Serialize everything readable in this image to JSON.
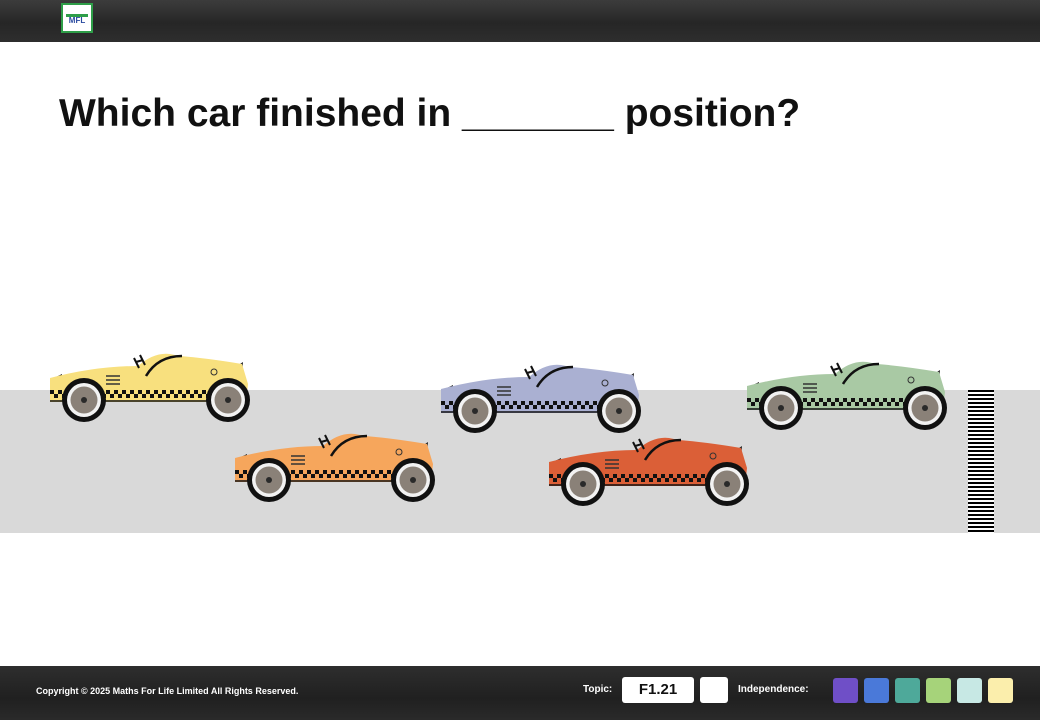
{
  "question": {
    "text": "Which car finished in _______ position?"
  },
  "cars": [
    {
      "id": "yellow",
      "body_color": "#f8e07e"
    },
    {
      "id": "orange",
      "body_color": "#f6a65c"
    },
    {
      "id": "blue",
      "body_color": "#aab0d2"
    },
    {
      "id": "red",
      "body_color": "#db5f37"
    },
    {
      "id": "green",
      "body_color": "#a9c9a4"
    }
  ],
  "footer": {
    "copyright": "Copyright © 2025 Maths For Life Limited All Rights Reserved.",
    "topic_label": "Topic:",
    "topic_code": "F1.21",
    "independence_label": "Independence:",
    "independence_colors": [
      "#6f4fc7",
      "#4a79d9",
      "#4ea99a",
      "#a6d37a",
      "#c7e8e4",
      "#fbeeac"
    ]
  },
  "logo": {
    "text": "MFL"
  }
}
